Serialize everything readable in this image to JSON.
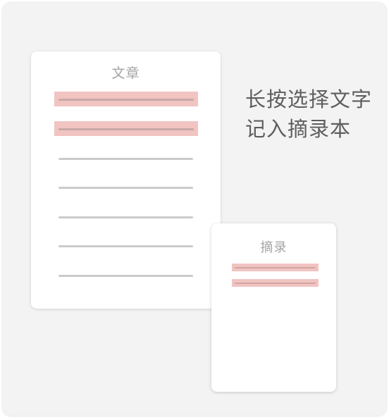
{
  "article_card": {
    "title": "文章",
    "highlighted_line_count": 2,
    "plain_line_count": 5
  },
  "excerpt_card": {
    "title": "摘录",
    "highlighted_line_count": 2
  },
  "caption": {
    "line1": "长按选择文字",
    "line2": "记入摘录本"
  },
  "colors": {
    "background": "#f3f3f3",
    "card": "#ffffff",
    "highlight": "#f1c4c1",
    "text_line": "#cbcbcb",
    "caption_text": "#5e5e5e",
    "card_title": "#a3a3a3"
  }
}
